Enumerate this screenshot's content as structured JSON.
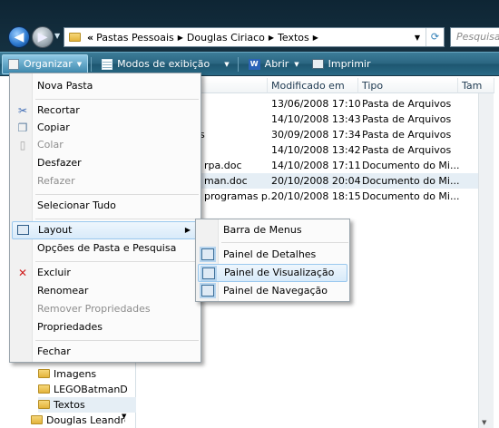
{
  "address": {
    "crumbs": [
      "Pastas Pessoais",
      "Douglas Ciriaco",
      "Textos"
    ],
    "search_placeholder": "Pesquisar"
  },
  "toolbar": {
    "organize": "Organizar",
    "views": "Modos de exibição",
    "open": "Abrir",
    "print": "Imprimir"
  },
  "columns": [
    "Modificado em",
    "Tipo",
    "Tam"
  ],
  "files": [
    {
      "name": "",
      "modified": "13/06/2008 17:10",
      "type": "Pasta de Arquivos",
      "selected": false
    },
    {
      "name": "",
      "modified": "14/10/2008 13:43",
      "type": "Pasta de Arquivos",
      "selected": false
    },
    {
      "name": "s",
      "modified": "30/09/2008 17:34",
      "type": "Pasta de Arquivos",
      "selected": false
    },
    {
      "name": "",
      "modified": "14/10/2008 13:42",
      "type": "Pasta de Arquivos",
      "selected": false
    },
    {
      "name": "rpa.doc",
      "modified": "14/10/2008 17:11",
      "type": "Documento do Mi...",
      "selected": false
    },
    {
      "name": "man.doc",
      "modified": "20/10/2008 20:04",
      "type": "Documento do Mi...",
      "selected": true
    },
    {
      "name": "programas p...",
      "modified": "20/10/2008 18:15",
      "type": "Documento do Mi...",
      "selected": false
    }
  ],
  "nav_tree": [
    {
      "label": "Imagens"
    },
    {
      "label": "LEGOBatmanD"
    },
    {
      "label": "Textos"
    },
    {
      "label": "Douglas Leandrc"
    }
  ],
  "menu": {
    "items": [
      {
        "label": "Nova Pasta",
        "disabled": false
      },
      {
        "label": "Recortar",
        "disabled": false
      },
      {
        "label": "Copiar",
        "disabled": false
      },
      {
        "label": "Colar",
        "disabled": true
      },
      {
        "label": "Desfazer",
        "disabled": false
      },
      {
        "label": "Refazer",
        "disabled": true
      },
      {
        "label": "Selecionar Tudo",
        "disabled": false
      },
      {
        "label": "Layout",
        "disabled": false
      },
      {
        "label": "Opções de Pasta e Pesquisa",
        "disabled": false
      },
      {
        "label": "Excluir",
        "disabled": false
      },
      {
        "label": "Renomear",
        "disabled": false
      },
      {
        "label": "Remover Propriedades",
        "disabled": true
      },
      {
        "label": "Propriedades",
        "disabled": false
      },
      {
        "label": "Fechar",
        "disabled": false
      }
    ]
  },
  "submenu": {
    "items": [
      {
        "label": "Barra de Menus"
      },
      {
        "label": "Painel de Detalhes"
      },
      {
        "label": "Painel de Visualização"
      },
      {
        "label": "Painel de Navegação"
      }
    ]
  }
}
